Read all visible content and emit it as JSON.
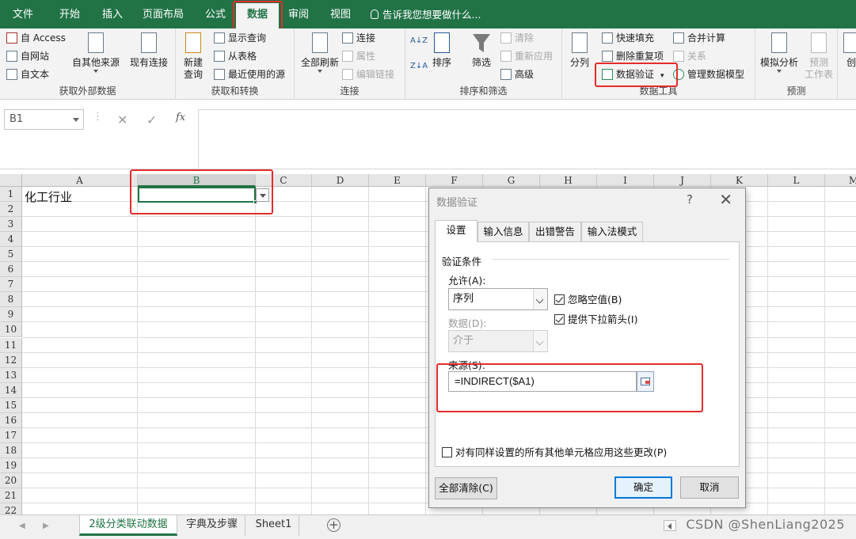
{
  "ribbon_tabs": [
    "文件",
    "开始",
    "插入",
    "页面布局",
    "公式",
    "数据",
    "审阅",
    "视图"
  ],
  "tell_me": "告诉我您想要做什么...",
  "groups": {
    "get_external": {
      "label": "获取外部数据",
      "small": [
        "自 Access",
        "自网站",
        "自文本"
      ],
      "from_other": "自其他来源",
      "existing": "现有连接"
    },
    "get_transform": {
      "label": "获取和转换",
      "new_query": "新建\n查询",
      "new_query_l1": "新建",
      "new_query_l2": "查询",
      "small": [
        "显示查询",
        "从表格",
        "最近使用的源"
      ]
    },
    "connections": {
      "label": "连接",
      "refresh_all": "全部刷新",
      "small": [
        "连接",
        "属性",
        "编辑链接"
      ]
    },
    "sort_filter": {
      "label": "排序和筛选",
      "sort": "排序",
      "filter": "筛选",
      "small": [
        "清除",
        "重新应用",
        "高级"
      ]
    },
    "data_tools": {
      "label": "数据工具",
      "split": "分列",
      "small": [
        "快速填充",
        "删除重复项",
        "数据验证",
        "合并计算",
        "关系",
        "管理数据模型"
      ]
    },
    "forecast": {
      "label": "预测",
      "whatif": "模拟分析",
      "sheet_l1": "预测",
      "sheet_l2": "工作表"
    },
    "outline": {
      "create": "创"
    }
  },
  "formula_bar": {
    "name_box": "B1",
    "fx": "fx",
    "value": ""
  },
  "columns": [
    "A",
    "B",
    "C",
    "D",
    "E",
    "F",
    "G",
    "H",
    "I",
    "J",
    "K",
    "L",
    "M"
  ],
  "rows": [
    "1",
    "2",
    "3",
    "4",
    "5",
    "6",
    "7",
    "8",
    "9",
    "10",
    "11",
    "12",
    "13",
    "14",
    "15",
    "16",
    "17",
    "18",
    "19",
    "20",
    "21",
    "22"
  ],
  "cells": {
    "A1": "化工行业"
  },
  "sheets": [
    "2级分类联动数据",
    "字典及步骤",
    "Sheet1"
  ],
  "active_sheet": "2级分类联动数据",
  "watermark": "CSDN @ShenLiang2025",
  "dialog": {
    "title": "数据验证",
    "help": "?",
    "close": "✕",
    "tabs": [
      "设置",
      "输入信息",
      "出错警告",
      "输入法模式"
    ],
    "criteria_label": "验证条件",
    "allow_label": "允许(A):",
    "allow_value": "序列",
    "data_label": "数据(D):",
    "data_value": "介于",
    "ignore_blank": "忽略空值(B)",
    "in_cell_dropdown": "提供下拉箭头(I)",
    "source_label": "来源(S):",
    "source_value": "=INDIRECT($A1)",
    "apply_all": "对有同样设置的所有其他单元格应用这些更改(P)",
    "clear_all": "全部清除(C)",
    "ok": "确定",
    "cancel": "取消"
  },
  "colors": {
    "excel_green": "#217346",
    "highlight_red": "#e52b2b",
    "dialog_bg": "#f0f0f0",
    "ok_border": "#0078d7"
  }
}
